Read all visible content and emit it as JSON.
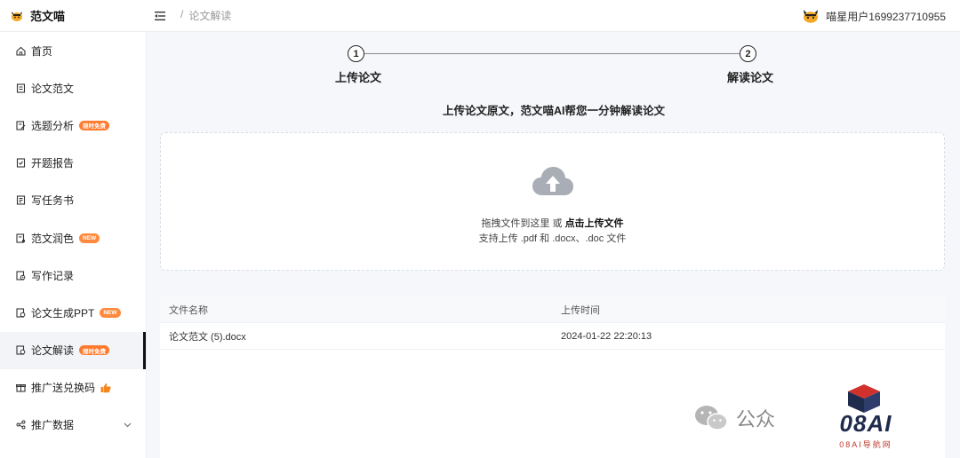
{
  "header": {
    "brand": "范文喵",
    "breadcrumb_sep": "/",
    "breadcrumb": "论文解读",
    "username": "喵星用户1699237710955"
  },
  "sidebar": {
    "items": [
      {
        "label": "首页",
        "icon": "home-icon"
      },
      {
        "label": "论文范文",
        "icon": "document-icon"
      },
      {
        "label": "选题分析",
        "icon": "edit-doc-icon",
        "badge": "限时免费"
      },
      {
        "label": "开题报告",
        "icon": "check-doc-icon"
      },
      {
        "label": "写任务书",
        "icon": "notebook-icon"
      },
      {
        "label": "范文润色",
        "icon": "polish-icon",
        "badge": "NEW"
      },
      {
        "label": "写作记录",
        "icon": "record-icon"
      },
      {
        "label": "论文生成PPT",
        "icon": "ppt-icon",
        "badge": "NEW"
      },
      {
        "label": "论文解读",
        "icon": "read-icon",
        "badge": "限时免费"
      },
      {
        "label": "推广送兑换码",
        "icon": "gift-icon"
      },
      {
        "label": "推广数据",
        "icon": "share-icon"
      }
    ]
  },
  "steps": {
    "step1_num": "1",
    "step1_label": "上传论文",
    "step2_num": "2",
    "step2_label": "解读论文",
    "subtitle": "上传论文原文，范文喵AI帮您一分钟解读论文"
  },
  "upload": {
    "text_prefix": "拖拽文件到这里 或 ",
    "text_link": "点击上传文件",
    "hint": "支持上传 .pdf 和 .docx、.doc 文件"
  },
  "table": {
    "headers": [
      "文件名称",
      "上传时间"
    ],
    "rows": [
      {
        "name": "论文范文 (5).docx",
        "time": "2024-01-22 22:20:13"
      }
    ]
  },
  "watermark": {
    "text": "公众",
    "logo": "08AI",
    "logo_sub": "08AI导航网"
  },
  "colors": {
    "accent": "#111111",
    "badge": "#ff7a2e",
    "cloud": "#a9adb6"
  }
}
